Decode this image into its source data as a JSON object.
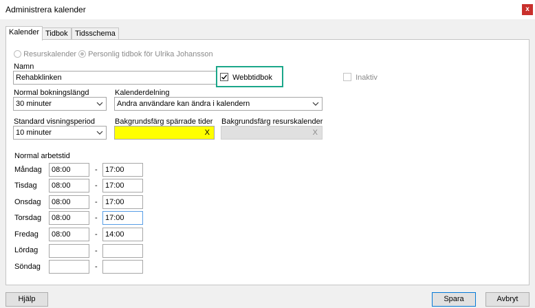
{
  "window": {
    "title": "Administrera kalender",
    "close_label": "x"
  },
  "tabs": [
    {
      "label": "Kalender"
    },
    {
      "label": "Tidbok"
    },
    {
      "label": "Tidsschema"
    }
  ],
  "calendar_type": {
    "option1": "Resurskalender",
    "option2": "Personlig tidbok för Ulrika Johansson"
  },
  "name": {
    "label": "Namn",
    "value": "Rehabklinken"
  },
  "webbtidbok": {
    "label": "Webbtidbok",
    "checked": true
  },
  "inaktiv": {
    "label": "Inaktiv",
    "checked": false
  },
  "booking_length": {
    "label": "Normal bokningslängd",
    "value": "30 minuter"
  },
  "sharing": {
    "label": "Kalenderdelning",
    "value": "Andra användare kan ändra i kalendern"
  },
  "view_period": {
    "label": "Standard visningsperiod",
    "value": "10 minuter"
  },
  "bg_blocked": {
    "label": "Bakgrundsfärg spärrade tider",
    "color": "#ffff00",
    "clear_label": "X"
  },
  "bg_resource": {
    "label": "Bakgrundsfärg resurskalender",
    "color": "#e0e0e0",
    "clear_label": "X"
  },
  "worktime": {
    "heading": "Normal arbetstid",
    "separator": "-",
    "days": [
      {
        "day": "Måndag",
        "start": "08:00",
        "end": "17:00"
      },
      {
        "day": "Tisdag",
        "start": "08:00",
        "end": "17:00"
      },
      {
        "day": "Onsdag",
        "start": "08:00",
        "end": "17:00"
      },
      {
        "day": "Torsdag",
        "start": "08:00",
        "end": "17:00"
      },
      {
        "day": "Fredag",
        "start": "08:00",
        "end": "14:00"
      },
      {
        "day": "Lördag",
        "start": "",
        "end": ""
      },
      {
        "day": "Söndag",
        "start": "",
        "end": ""
      }
    ]
  },
  "buttons": {
    "help": "Hjälp",
    "save": "Spara",
    "cancel": "Avbryt"
  },
  "colors": {
    "highlight": "#1aa689",
    "focus": "#569de5",
    "close": "#c9302c"
  }
}
